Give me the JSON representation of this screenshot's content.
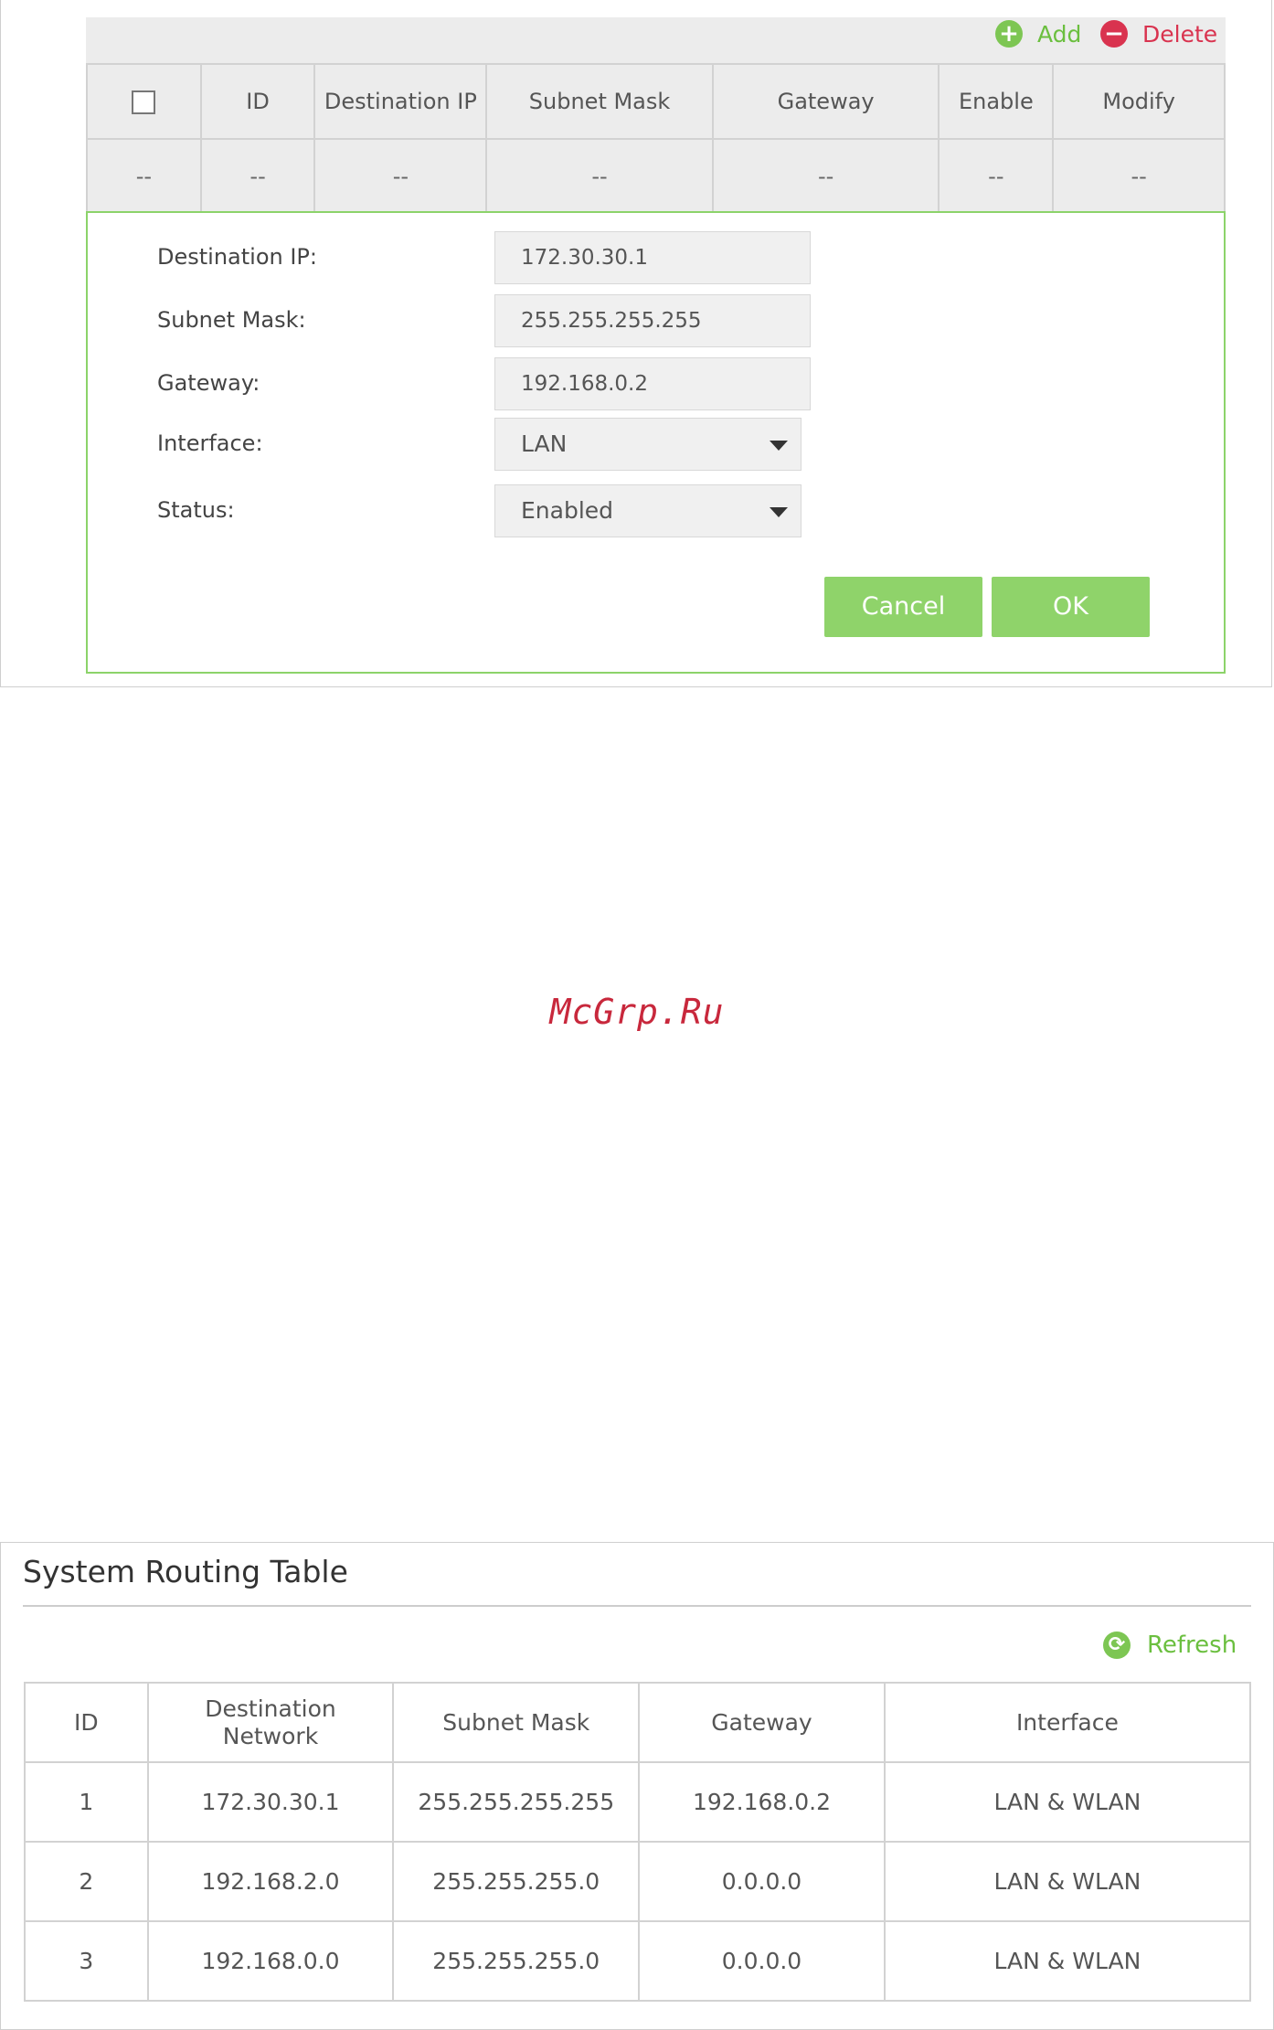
{
  "rule_toolbar": {
    "add_label": "Add",
    "delete_label": "Delete"
  },
  "rule_table": {
    "headers": [
      "ID",
      "Destination IP",
      "Subnet Mask",
      "Gateway",
      "Enable",
      "Modify"
    ],
    "placeholder_row": [
      "--",
      "--",
      "--",
      "--",
      "--",
      "--",
      "--"
    ]
  },
  "edit_form": {
    "destination_ip": {
      "label": "Destination IP:",
      "value": "172.30.30.1"
    },
    "subnet_mask": {
      "label": "Subnet Mask:",
      "value": "255.255.255.255"
    },
    "gateway": {
      "label": "Gateway:",
      "value": "192.168.0.2"
    },
    "interface": {
      "label": "Interface:",
      "value": "LAN"
    },
    "status": {
      "label": "Status:",
      "value": "Enabled"
    },
    "cancel_label": "Cancel",
    "ok_label": "OK"
  },
  "watermark": "McGrp.Ru",
  "system_routing": {
    "title": "System Routing Table",
    "refresh_label": "Refresh",
    "headers": [
      "ID",
      "Destination Network",
      "Subnet Mask",
      "Gateway",
      "Interface"
    ],
    "rows": [
      [
        "1",
        "172.30.30.1",
        "255.255.255.255",
        "192.168.0.2",
        "LAN & WLAN"
      ],
      [
        "2",
        "192.168.2.0",
        "255.255.255.0",
        "0.0.0.0",
        "LAN & WLAN"
      ],
      [
        "3",
        "192.168.0.0",
        "255.255.255.0",
        "0.0.0.0",
        "LAN & WLAN"
      ]
    ]
  },
  "colors": {
    "accent_green": "#7dc653",
    "delete_red": "#d9334f",
    "form_border": "#8cd36a"
  }
}
